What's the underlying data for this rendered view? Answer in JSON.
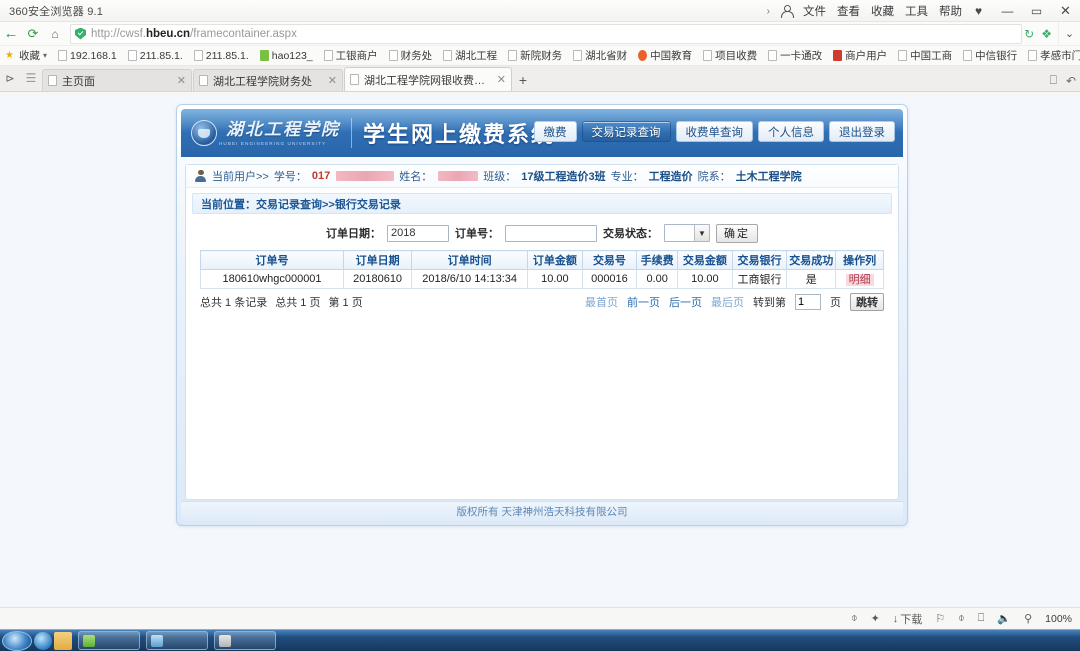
{
  "browser": {
    "app_title": "360安全浏览器 9.1",
    "menu": [
      "文件",
      "查看",
      "收藏",
      "工具",
      "帮助"
    ],
    "menu_chevron": "›",
    "window_buttons": [
      "♥",
      "—",
      "▭",
      "✕"
    ],
    "nav": {
      "back": "←",
      "reload": "⟳",
      "home": "⌂"
    },
    "url": {
      "scheme": "http://cwsf.",
      "domain": "hbeu.cn",
      "path": "/framecontainer.aspx"
    },
    "url_right_icons": [
      "refresh-icon",
      "shield-icon"
    ],
    "url_dropdown": "⌄",
    "bookmarks_label": "收藏",
    "bookmarks_caret": "▾",
    "bookmarks": [
      {
        "label": "192.168.1",
        "icon": "page-icon"
      },
      {
        "label": "211.85.1.",
        "icon": "page-icon"
      },
      {
        "label": "211.85.1.",
        "icon": "page-icon"
      },
      {
        "label": "hao123_",
        "icon": "hao123-icon"
      },
      {
        "label": "工银商户",
        "icon": "page-icon"
      },
      {
        "label": "财务处",
        "icon": "page-icon"
      },
      {
        "label": "湖北工程",
        "icon": "page-icon"
      },
      {
        "label": "新院财务",
        "icon": "page-icon"
      },
      {
        "label": "湖北省财",
        "icon": "page-icon"
      },
      {
        "label": "中国教育",
        "icon": "edu-icon"
      },
      {
        "label": "项目收费",
        "icon": "page-icon"
      },
      {
        "label": "一卡通改",
        "icon": "page-icon"
      },
      {
        "label": "商户用户",
        "icon": "merchant-icon"
      },
      {
        "label": "中国工商",
        "icon": "page-icon"
      },
      {
        "label": "中信银行",
        "icon": "page-icon"
      },
      {
        "label": "孝感市门",
        "icon": "page-icon"
      }
    ],
    "bookmarks_overflow": "»",
    "tabs": [
      {
        "label": "主页面",
        "active": false
      },
      {
        "label": "湖北工程学院财务处",
        "active": false
      },
      {
        "label": "湖北工程学院网银收费系统",
        "active": true
      }
    ],
    "tab_close": "✕",
    "tab_new": "+",
    "tabstrip_right_icons": [
      "window-icon",
      "undo-icon"
    ]
  },
  "site": {
    "logo_cn": "湖北工程学院",
    "logo_en": "HUBEI ENGINEERING UNIVERSITY",
    "title": "学生网上缴费系统",
    "nav": [
      {
        "label": "缴费",
        "active": false
      },
      {
        "label": "交易记录查询",
        "active": true
      },
      {
        "label": "收费单查询",
        "active": false
      },
      {
        "label": "个人信息",
        "active": false
      },
      {
        "label": "退出登录",
        "active": false
      }
    ],
    "footer": "版权所有 天津神州浩天科技有限公司"
  },
  "userbar": {
    "prefix": "当前用户>>",
    "id_label": "学号：",
    "id_value": "017",
    "name_label": "姓名：",
    "class_label": "班级：",
    "class_value": "17级工程造价3班",
    "major_label": "专业：",
    "major_value": "工程造价",
    "dept_label": "院系：",
    "dept_value": "土木工程学院"
  },
  "breadcrumb": "当前位置：交易记录查询>>银行交易记录",
  "filter": {
    "date_label": "订单日期：",
    "date_value": "2018",
    "order_label": "订单号：",
    "order_value": "",
    "status_label": "交易状态：",
    "status_value": "",
    "status_arrow": "▼",
    "submit_label": "确定"
  },
  "table": {
    "headers": [
      "订单号",
      "订单日期",
      "订单时间",
      "订单金额",
      "交易号",
      "手续费",
      "交易金额",
      "交易银行",
      "交易成功",
      "操作列"
    ],
    "rows": [
      {
        "order_no": "180610whgc000001",
        "order_date": "20180610",
        "order_time": "2018/6/10 14:13:34",
        "order_amount": "10.00",
        "trans_no": "000016",
        "fee": "0.00",
        "trans_amount": "10.00",
        "bank": "工商银行",
        "success": "是",
        "action": "明细"
      }
    ]
  },
  "pager": {
    "total_records": "总共 1 条记录",
    "total_pages": "总共 1 页",
    "current_page": "第 1 页",
    "first": "最首页",
    "prev": "前一页",
    "next": "后一页",
    "last": "最后页",
    "goto_label": "转到第",
    "goto_value": "1",
    "page_unit": "页",
    "jump": "跳转"
  },
  "statusbar": {
    "icons": [
      "plugin-icon",
      "pin-icon",
      "download-icon",
      "flag-icon",
      "shield-icon",
      "window-icon",
      "sound-icon",
      "search-icon"
    ],
    "download_label": "下载",
    "zoom": "100%"
  }
}
